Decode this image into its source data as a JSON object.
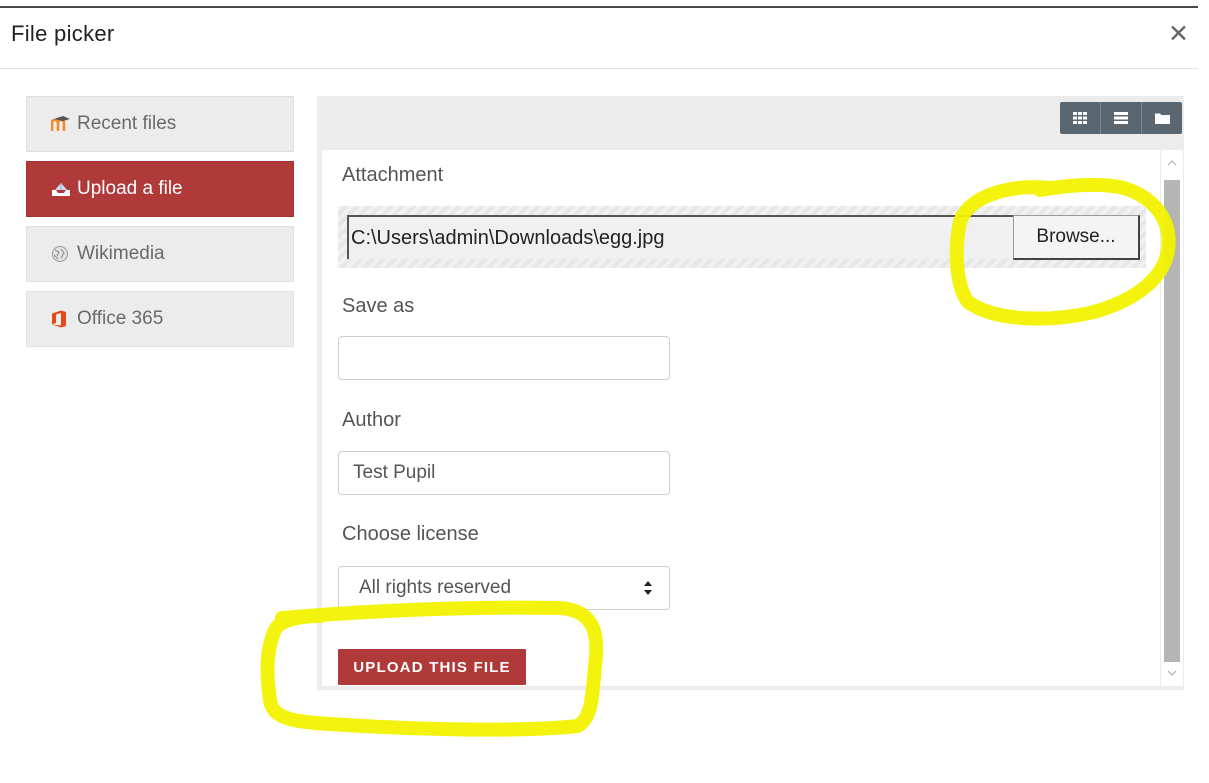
{
  "dialog": {
    "title": "File picker",
    "close_icon": "close-icon"
  },
  "sidebar": {
    "items": [
      {
        "label": "Recent files",
        "icon": "moodle-icon",
        "active": false
      },
      {
        "label": "Upload a file",
        "icon": "upload-icon",
        "active": true
      },
      {
        "label": "Wikimedia",
        "icon": "wikimedia-icon",
        "active": false
      },
      {
        "label": "Office 365",
        "icon": "office-icon",
        "active": false
      }
    ]
  },
  "toolbar": {
    "view_buttons": [
      "grid-view-icon",
      "list-view-icon",
      "folder-view-icon"
    ]
  },
  "form": {
    "attachment_label": "Attachment",
    "file_path": "C:\\Users\\admin\\Downloads\\egg.jpg",
    "browse_label": "Browse...",
    "save_as_label": "Save as",
    "save_as_value": "",
    "author_label": "Author",
    "author_value": "Test Pupil",
    "license_label": "Choose license",
    "license_value": "All rights reserved",
    "upload_label": "UPLOAD THIS FILE"
  },
  "colors": {
    "accent": "#b03a3a",
    "sidebar_bg": "#ececec",
    "view_button_bg": "#5b6770",
    "highlight": "#f2f200"
  }
}
